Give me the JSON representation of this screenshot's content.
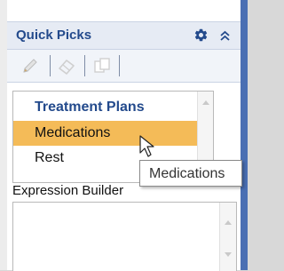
{
  "panel": {
    "title": "Quick Picks",
    "gear_icon": "gear-icon",
    "collapse_icon": "double-chevron-up-icon"
  },
  "toolbar": {
    "buttons": [
      {
        "name": "pencil-icon"
      },
      {
        "name": "eraser-icon"
      },
      {
        "name": "copy-document-icon"
      }
    ]
  },
  "list": {
    "items": [
      {
        "label": "Treatment Plans",
        "type": "header"
      },
      {
        "label": "Medications",
        "type": "selected"
      },
      {
        "label": "Rest",
        "type": "normal"
      }
    ]
  },
  "expression_builder": {
    "label": "Expression Builder"
  },
  "tooltip": {
    "text": "Medications"
  },
  "colors": {
    "accent": "#234a8c",
    "selected": "#f4bb58",
    "header_bg": "#e6ebf4",
    "right_bar": "#4a6fb3"
  }
}
